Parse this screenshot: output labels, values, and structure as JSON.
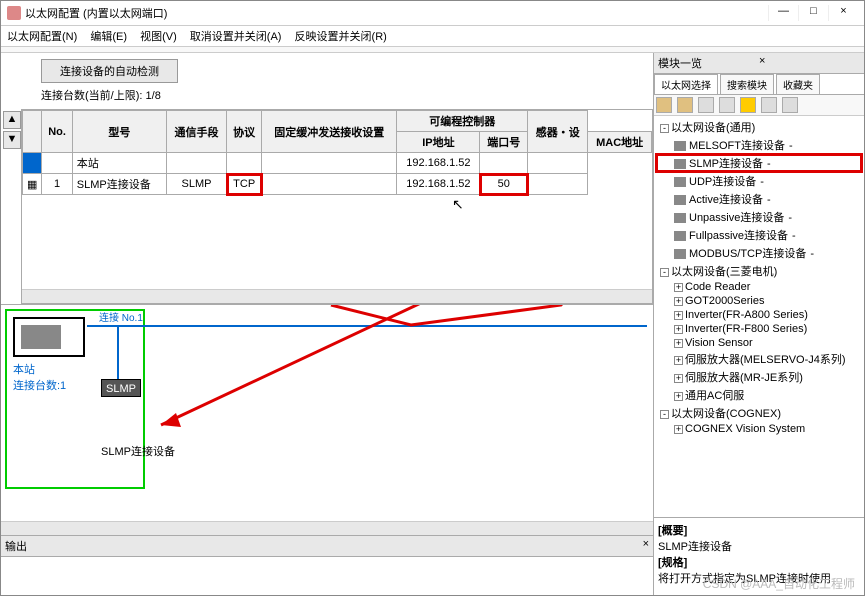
{
  "window": {
    "title": "以太网配置 (内置以太网端口)",
    "minimize": "—",
    "maximize": "□",
    "close": "×"
  },
  "menu": {
    "config": "以太网配置(N)",
    "edit": "编辑(E)",
    "view": "视图(V)",
    "cancel_close": "取消设置并关闭(A)",
    "apply_close": "反映设置并关闭(R)"
  },
  "top": {
    "auto_detect": "连接设备的自动检测",
    "count_label": "连接台数(当前/上限):",
    "count_value": "1/8"
  },
  "table": {
    "headers": {
      "no": "No.",
      "model": "型号",
      "comm": "通信手段",
      "proto": "协议",
      "fixed": "固定缓冲发送接收设置",
      "plc": "可编程控制器",
      "ip": "IP地址",
      "port": "端口号",
      "sensor": "感器・设",
      "mac": "MAC地址"
    },
    "rows": [
      {
        "no": "",
        "model": "本站",
        "comm": "",
        "proto": "",
        "fixed": "",
        "ip": "192.168.1.52",
        "port": "",
        "mac": ""
      },
      {
        "no": "1",
        "model": "SLMP连接设备",
        "comm": "SLMP",
        "proto": "TCP",
        "fixed": "",
        "ip": "192.168.1.52",
        "port": "50",
        "mac": ""
      }
    ]
  },
  "sidebuttons": {
    "up": "▲",
    "down": "▼"
  },
  "diagram": {
    "station": "本站",
    "conn_count": "连接台数:1",
    "conn_label": "连接\nNo.1",
    "slmp": "SLMP",
    "slmp_device": "SLMP连接设备"
  },
  "modules": {
    "panel_title": "模块一览",
    "close": "×",
    "tabs": {
      "select": "以太网选择",
      "search": "搜索模块",
      "fav": "收藏夹"
    },
    "tree": [
      {
        "lvl": 1,
        "exp": "-",
        "label": "以太网设备(通用)"
      },
      {
        "lvl": 2,
        "icon": true,
        "label": "MELSOFT连接设备",
        "dash": "-"
      },
      {
        "lvl": 2,
        "icon": true,
        "label": "SLMP连接设备",
        "dash": "-",
        "highlight": true
      },
      {
        "lvl": 2,
        "icon": true,
        "label": "UDP连接设备",
        "dash": "-"
      },
      {
        "lvl": 2,
        "icon": true,
        "label": "Active连接设备",
        "dash": "-"
      },
      {
        "lvl": 2,
        "icon": true,
        "label": "Unpassive连接设备",
        "dash": "-"
      },
      {
        "lvl": 2,
        "icon": true,
        "label": "Fullpassive连接设备",
        "dash": "-"
      },
      {
        "lvl": 2,
        "icon": true,
        "label": "MODBUS/TCP连接设备",
        "dash": "-"
      },
      {
        "lvl": 1,
        "exp": "-",
        "label": "以太网设备(三菱电机)"
      },
      {
        "lvl": 2,
        "exp": "+",
        "label": "Code Reader"
      },
      {
        "lvl": 2,
        "exp": "+",
        "label": "GOT2000Series"
      },
      {
        "lvl": 2,
        "exp": "+",
        "label": "Inverter(FR-A800 Series)"
      },
      {
        "lvl": 2,
        "exp": "+",
        "label": "Inverter(FR-F800 Series)"
      },
      {
        "lvl": 2,
        "exp": "+",
        "label": "Vision Sensor"
      },
      {
        "lvl": 2,
        "exp": "+",
        "label": "伺服放大器(MELSERVO-J4系列)"
      },
      {
        "lvl": 2,
        "exp": "+",
        "label": "伺服放大器(MR-JE系列)"
      },
      {
        "lvl": 2,
        "exp": "+",
        "label": "通用AC伺服"
      },
      {
        "lvl": 1,
        "exp": "-",
        "label": "以太网设备(COGNEX)"
      },
      {
        "lvl": 2,
        "exp": "+",
        "label": "COGNEX Vision System"
      }
    ],
    "info": {
      "summary_label": "[概要]",
      "summary": "SLMP连接设备",
      "spec_label": "[规格]",
      "spec": "将打开方式指定为SLMP连接时使用"
    }
  },
  "output": {
    "title": "输出",
    "close": "×"
  },
  "watermark": "CSDN @AAA_自动化工程师"
}
